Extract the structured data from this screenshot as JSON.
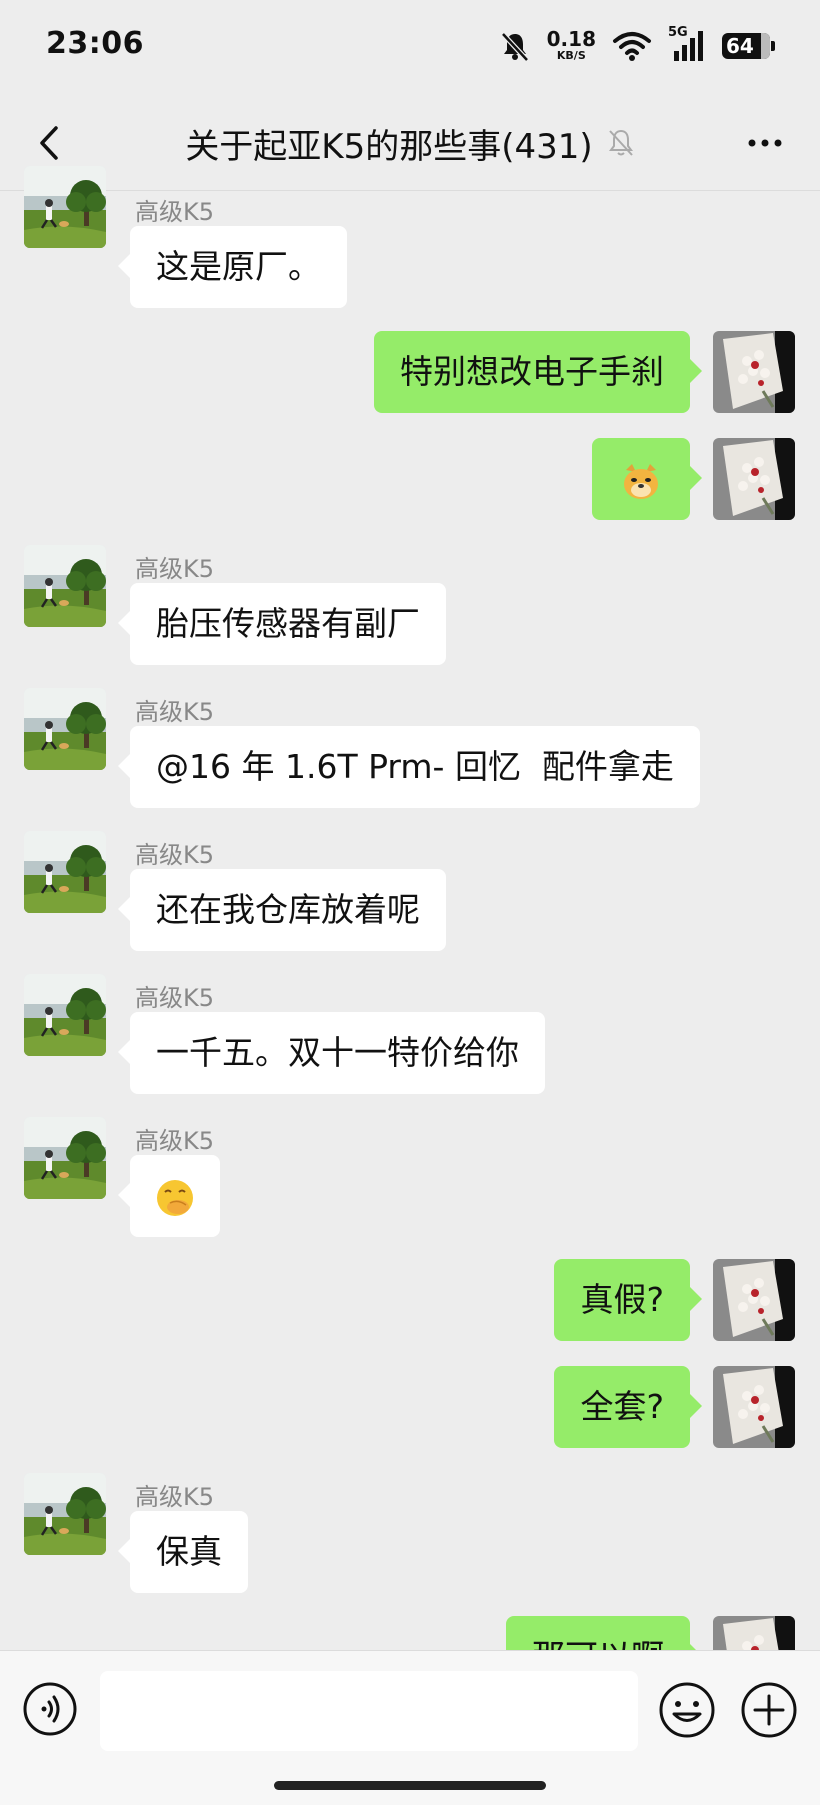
{
  "status_bar": {
    "time": "23:06",
    "net_speed": "0.18",
    "net_unit": "KB/S",
    "network": "5G",
    "battery": "64"
  },
  "header": {
    "title": "关于起亚K5的那些事(431)",
    "muted_icon": "bell-off-icon",
    "more_icon": "more-icon"
  },
  "sender_name": "高级K5",
  "messages": [
    {
      "dir": "in",
      "text": "这是原厂。"
    },
    {
      "dir": "out",
      "text": "特别想改电子手刹"
    },
    {
      "dir": "out",
      "emoji": "doge"
    },
    {
      "dir": "in",
      "text": "胎压传感器有副厂"
    },
    {
      "dir": "in",
      "text": "@16 年 1.6T Prm- 回忆  配件拿走"
    },
    {
      "dir": "in",
      "text": "还在我仓库放着呢"
    },
    {
      "dir": "in",
      "text": "一千五。双十一特价给你"
    },
    {
      "dir": "in",
      "emoji": "hand-over-mouth"
    },
    {
      "dir": "out",
      "text": "真假?"
    },
    {
      "dir": "out",
      "text": "全套?"
    },
    {
      "dir": "in",
      "text": "保真"
    },
    {
      "dir": "out",
      "text": "那可以啊"
    }
  ],
  "input_bar": {
    "voice_icon": "voice-icon",
    "emoji_icon": "emoji-icon",
    "plus_icon": "plus-icon",
    "text": ""
  },
  "colors": {
    "background": "#ededed",
    "outgoing_bubble": "#95ec69",
    "incoming_bubble": "#ffffff"
  }
}
